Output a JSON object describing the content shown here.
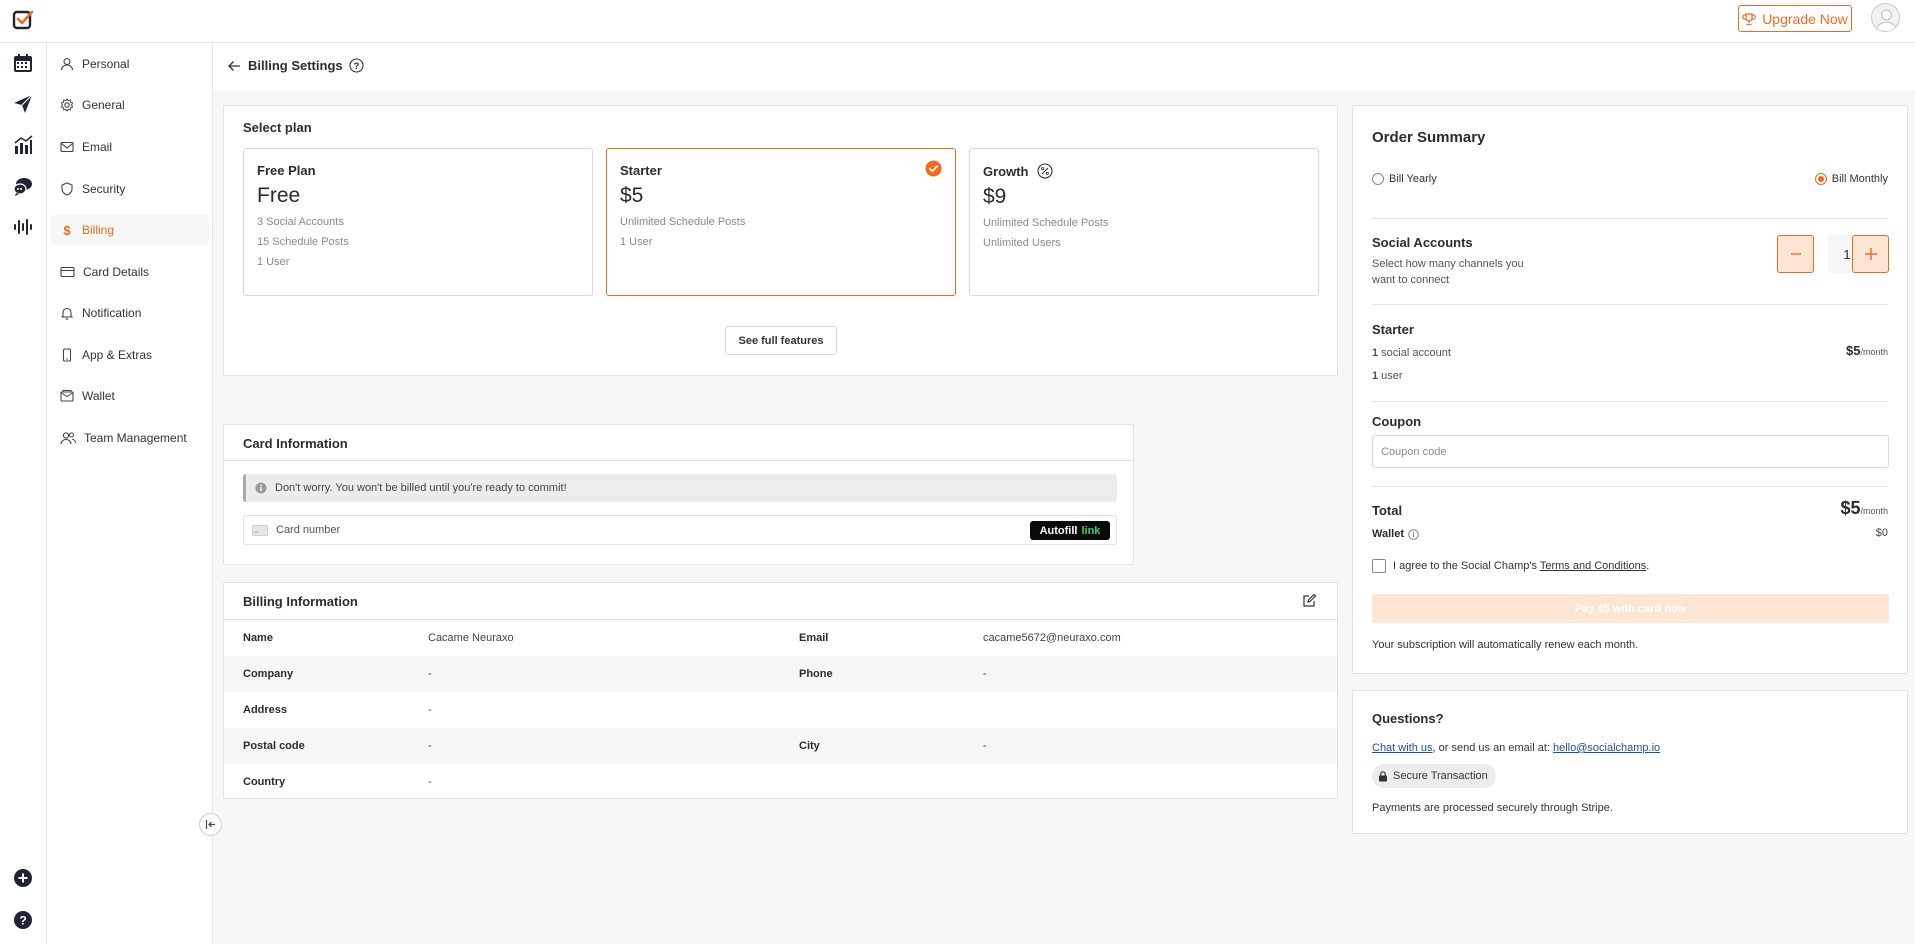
{
  "topbar": {
    "upgrade_label": "Upgrade Now"
  },
  "rail": {
    "icons": [
      "calendar-icon",
      "send-icon",
      "analytics-icon",
      "chat-icon",
      "audio-wave-icon",
      "add-circle-icon",
      "help-icon"
    ]
  },
  "sidebar": {
    "items": [
      {
        "label": "Personal",
        "icon": "user-icon"
      },
      {
        "label": "General",
        "icon": "gear-icon"
      },
      {
        "label": "Email",
        "icon": "mail-icon"
      },
      {
        "label": "Security",
        "icon": "shield-icon"
      },
      {
        "label": "Billing",
        "icon": "dollar-icon",
        "active": true
      },
      {
        "label": "Card Details",
        "icon": "card-icon"
      },
      {
        "label": "Notification",
        "icon": "bell-icon"
      },
      {
        "label": "App & Extras",
        "icon": "phone-icon"
      },
      {
        "label": "Wallet",
        "icon": "wallet-icon"
      },
      {
        "label": "Team Management",
        "icon": "team-icon"
      }
    ]
  },
  "page": {
    "title": "Billing Settings"
  },
  "select_plan": {
    "title": "Select plan",
    "features_button": "See full features",
    "plans": [
      {
        "name": "Free Plan",
        "price": "Free",
        "features": [
          "3 Social Accounts",
          "15 Schedule Posts",
          "1 User"
        ]
      },
      {
        "name": "Starter",
        "price": "$5",
        "features": [
          "Unlimited Schedule Posts",
          "1 User"
        ],
        "selected": true
      },
      {
        "name": "Growth",
        "price": "$9",
        "features": [
          "Unlimited Schedule Posts",
          "Unlimited Users"
        ]
      }
    ]
  },
  "card_info": {
    "title": "Card Information",
    "notice": "Don't worry. You won't be billed until you're ready to commit!",
    "card_placeholder": "Card number",
    "autofill_label": "Autofill",
    "autofill_link": "link"
  },
  "billing_info": {
    "title": "Billing Information",
    "rows": [
      {
        "label": "Name",
        "value": "Cacame Neuraxo",
        "label2": "Email",
        "value2": "cacame5672@neuraxo.com"
      },
      {
        "label": "Company",
        "value": "-",
        "label2": "Phone",
        "value2": "-"
      },
      {
        "label": "Address",
        "value": "-",
        "label2": "",
        "value2": ""
      },
      {
        "label": "Postal code",
        "value": "-",
        "label2": "City",
        "value2": "-"
      },
      {
        "label": "Country",
        "value": "-",
        "label2": "",
        "value2": ""
      }
    ]
  },
  "order_summary": {
    "title": "Order Summary",
    "bill_yearly": "Bill Yearly",
    "bill_monthly": "Bill Monthly",
    "social_title": "Social Accounts",
    "social_desc_1": "Select how many channels you",
    "social_desc_2": "want to connect",
    "quantity": "1",
    "plan_name": "Starter",
    "line1_count": "1",
    "line1_text": " social account",
    "line1_price": "$5",
    "per_month": "/month",
    "line2_count": "1",
    "line2_text": " user",
    "coupon_title": "Coupon",
    "coupon_placeholder": "Coupon code",
    "total_label": "Total",
    "total_price": "$5",
    "wallet_label": "Wallet",
    "wallet_value": "$0",
    "agree_prefix": "I agree to the Social Champ's ",
    "agree_link": "Terms and Conditions",
    "agree_suffix": ".",
    "pay_button": "Pay $5 with card now",
    "renew_text": "Your subscription will automatically renew each month."
  },
  "questions": {
    "title": "Questions?",
    "chat_link": "Chat with us",
    "middle_text": ", or send us an email at: ",
    "email_link": "hello@socialchamp.io",
    "secure_label": "Secure Transaction",
    "stripe_text": "Payments are processed securely through Stripe."
  },
  "colors": {
    "accent": "#f26a21",
    "accent_soft": "#fde5d3",
    "link": "#1f4ea3"
  }
}
